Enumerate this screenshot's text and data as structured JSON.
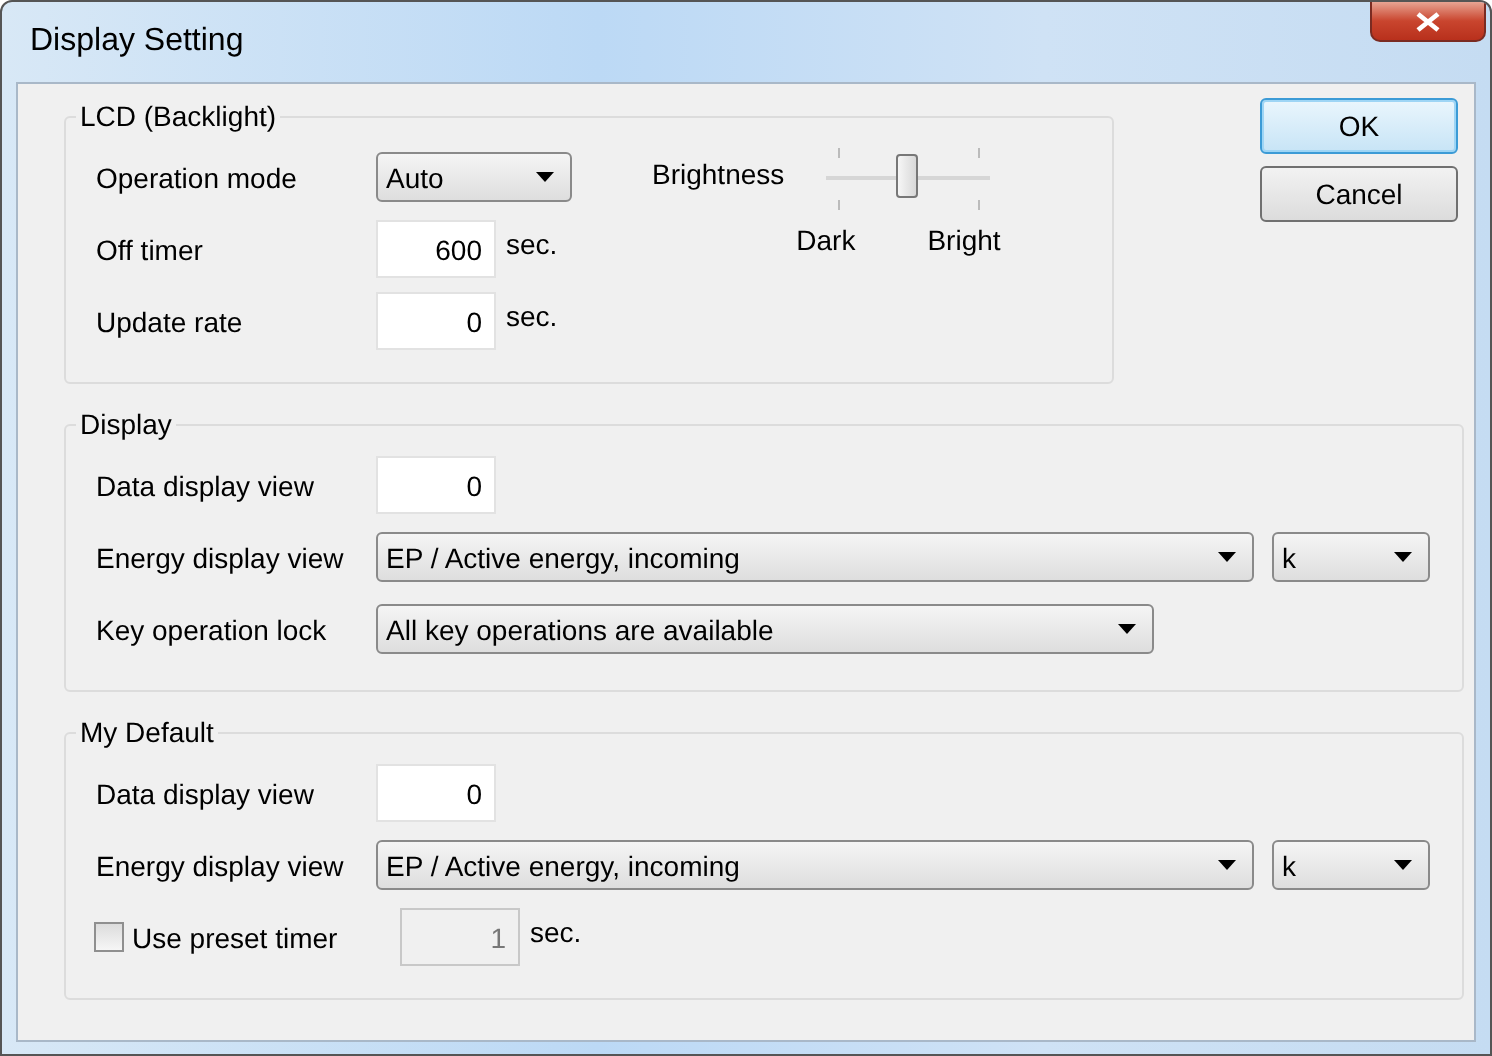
{
  "window": {
    "title": "Display Setting"
  },
  "lcd": {
    "title": "LCD (Backlight)",
    "rows": [
      {
        "kind": "mode",
        "label": "Operation mode",
        "value": "Auto"
      },
      {
        "kind": "number",
        "label": "Off timer",
        "value": "600",
        "unit": "sec."
      },
      {
        "kind": "number",
        "label": "Update rate",
        "value": "0",
        "unit": "sec."
      }
    ],
    "brightness": {
      "label": "Brightness",
      "level": 0.5,
      "min_label": "Dark",
      "max_label": "Bright"
    }
  },
  "buttons": [
    {
      "label": "OK",
      "default": true
    },
    {
      "label": "Cancel",
      "default": false
    }
  ],
  "groups": [
    {
      "title": "Display",
      "rows": [
        {
          "kind": "number",
          "label": "Data display view",
          "value": "0"
        },
        {
          "kind": "energy",
          "label": "Energy display view",
          "value": "EP / Active energy, incoming",
          "unit_value": "k"
        },
        {
          "kind": "lock",
          "label": "Key operation lock",
          "value": "All key operations are available"
        }
      ]
    },
    {
      "title": "My Default",
      "rows": [
        {
          "kind": "number",
          "label": "Data display view",
          "value": "0"
        },
        {
          "kind": "energy",
          "label": "Energy display view",
          "value": "EP / Active energy, incoming",
          "unit_value": "k"
        },
        {
          "kind": "checkbox",
          "label": "Use preset timer",
          "checked": false,
          "value": "1",
          "unit": "sec.",
          "disabled": true
        }
      ]
    }
  ]
}
